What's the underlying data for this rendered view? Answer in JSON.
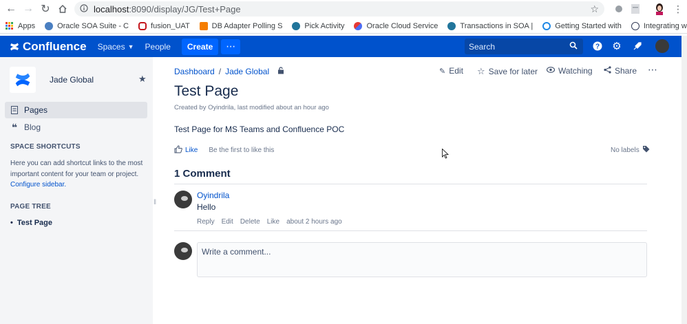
{
  "browser": {
    "url_host": "localhost",
    "url_path": ":8090/display/JG/Test+Page"
  },
  "bookmarks": [
    {
      "label": "Apps",
      "color": "#ea4335"
    },
    {
      "label": "Oracle SOA Suite - C",
      "color": "#4a7fc1"
    },
    {
      "label": "fusion_UAT",
      "color": "#c4161c"
    },
    {
      "label": "DB Adapter Polling S",
      "color": "#f57d00"
    },
    {
      "label": "Pick Activity",
      "color": "#21759b"
    },
    {
      "label": "Oracle Cloud Service",
      "color": "#4c6ef5"
    },
    {
      "label": "Transactions in SOA |",
      "color": "#21759b"
    },
    {
      "label": "Getting Started with",
      "color": "#1e88e5"
    },
    {
      "label": "Integrating with the",
      "color": "#333a56"
    }
  ],
  "header": {
    "product": "Confluence",
    "spaces": "Spaces",
    "people": "People",
    "create": "Create",
    "search_placeholder": "Search",
    "brand_color": "#0052cc"
  },
  "sidebar": {
    "space_name": "Jade Global",
    "items": [
      {
        "label": "Pages"
      },
      {
        "label": "Blog"
      }
    ],
    "shortcuts_heading": "SPACE SHORTCUTS",
    "shortcuts_text": "Here you can add shortcut links to the most important content for your team or project.",
    "configure_link": "Configure sidebar.",
    "tree_heading": "PAGE TREE",
    "tree_item": "Test Page"
  },
  "breadcrumb": {
    "dashboard": "Dashboard",
    "space": "Jade Global"
  },
  "actions": {
    "edit": "Edit",
    "save_later": "Save for later",
    "watching": "Watching",
    "share": "Share"
  },
  "page": {
    "title": "Test Page",
    "byline": "Created by Oyindrila, last modified about an hour ago",
    "body": "Test Page for MS Teams and Confluence POC",
    "like": "Like",
    "like_hint": "Be the first to like this",
    "labels": "No labels"
  },
  "comments": {
    "heading": "1 Comment",
    "author": "Oyindrila",
    "body": "Hello",
    "reply": "Reply",
    "edit": "Edit",
    "delete": "Delete",
    "like": "Like",
    "time": "about 2 hours ago",
    "placeholder": "Write a comment..."
  }
}
